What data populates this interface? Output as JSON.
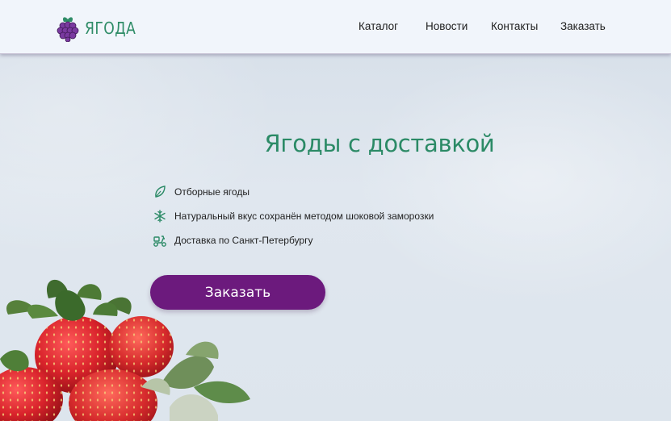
{
  "header": {
    "logo_text": "ЯГОДА",
    "logo_icon": "raspberry-icon",
    "nav": [
      {
        "label": "Каталог"
      },
      {
        "label": "Новости"
      },
      {
        "label": "Контакты"
      },
      {
        "label": "Заказать"
      }
    ]
  },
  "hero": {
    "title": "Ягоды с доставкой",
    "features": [
      {
        "icon": "leaf-icon",
        "text": "Отборные ягоды"
      },
      {
        "icon": "snowflake-icon",
        "text": "Натуральный вкус сохранён методом шоковой заморозки"
      },
      {
        "icon": "delivery-scooter-icon",
        "text": "Доставка по Санкт-Петербургу"
      }
    ],
    "order_button": "Заказать",
    "image": "strawberries"
  },
  "colors": {
    "accent_green": "#2b8a66",
    "button_purple": "#6c1a7d",
    "header_bg": "#f1f5fb"
  }
}
